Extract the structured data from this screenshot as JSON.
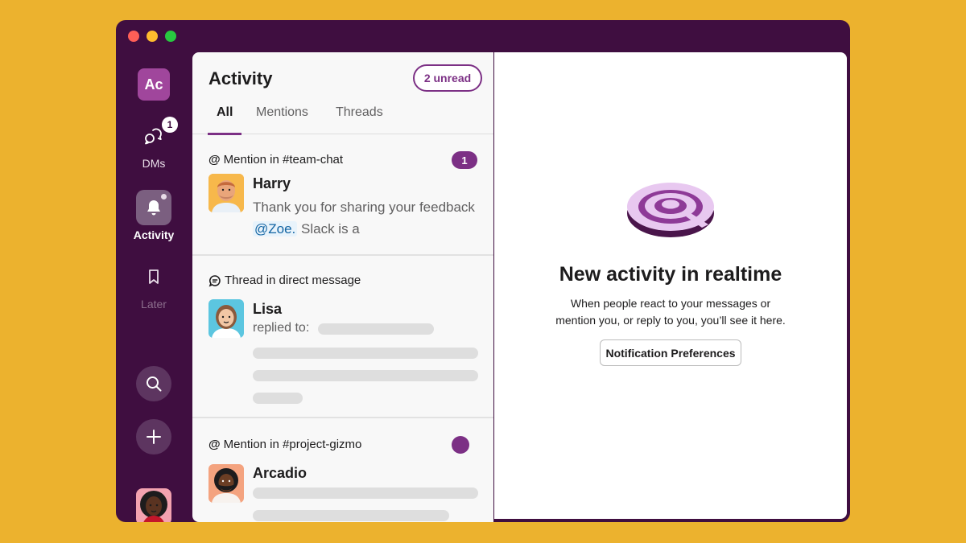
{
  "window": {
    "controls": [
      "close",
      "minimize",
      "maximize"
    ]
  },
  "rail": {
    "workspace_initials": "Ac",
    "items": [
      {
        "label": "DMs",
        "icon": "dm-icon",
        "badge": "1"
      },
      {
        "label": "Activity",
        "icon": "bell-icon",
        "active": true
      },
      {
        "label": "Later",
        "icon": "bookmark-icon"
      }
    ],
    "search_icon": "search-icon",
    "add_icon": "plus-icon",
    "user_status": "online"
  },
  "panel": {
    "title": "Activity",
    "unread": "2 unread",
    "tabs": [
      {
        "label": "All",
        "active": true
      },
      {
        "label": "Mentions"
      },
      {
        "label": "Threads"
      }
    ],
    "items": [
      {
        "kind": "@ Mention in #team-chat",
        "head_icon": "at-icon",
        "head_text": "Mention in #team-chat",
        "badge": "1",
        "name": "Harry",
        "msg_before": "Thank you for sharing your feedback ",
        "mention": "@Zoe.",
        "msg_after": " Slack is a"
      },
      {
        "head_icon": "thread-icon",
        "head_text": "Thread in direct message",
        "name": "Lisa",
        "msg": "replied to:"
      },
      {
        "head_icon": "at-icon",
        "head_text": "Mention in #project-gizmo",
        "name": "Arcadio",
        "unread_dot": true
      }
    ]
  },
  "right": {
    "illustration": "at-symbol-illustration",
    "title": "New activity in realtime",
    "text": "When people react to your messages or mention you, or reply to you, you’ll see it here.",
    "button": "Notification Preferences"
  },
  "colors": {
    "background": "#ECB22E",
    "sidebar": "#3F0E40",
    "accent": "#7C3085",
    "mention": "#1264A3"
  }
}
